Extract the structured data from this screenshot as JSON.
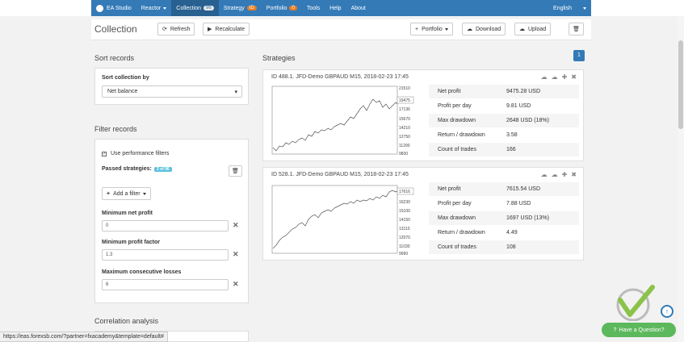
{
  "nav": {
    "brand": "EA Studio",
    "items": [
      {
        "label": "Reactor",
        "badge": "",
        "dropdown": true
      },
      {
        "label": "Collection",
        "badge": "96",
        "active": true
      },
      {
        "label": "Strategy",
        "badge": "ID"
      },
      {
        "label": "Portfolio",
        "badge": "0"
      },
      {
        "label": "Tools"
      },
      {
        "label": "Help"
      },
      {
        "label": "About"
      }
    ],
    "language": "English"
  },
  "header": {
    "title": "Collection",
    "refresh": "Refresh",
    "recalculate": "Recalculate",
    "portfolio": "Portfolio",
    "download": "Download",
    "upload": "Upload"
  },
  "sort": {
    "section_title": "Sort records",
    "label": "Sort collection by",
    "value": "Net balance"
  },
  "filter": {
    "section_title": "Filter records",
    "use_performance": "Use performance filters",
    "passed_label": "Passed strategies:",
    "passed_badge": "3 of 96",
    "add_filter": "Add a filter",
    "min_net_profit_label": "Minimum net profit",
    "min_net_profit_value": "0",
    "min_profit_factor_label": "Minimum profit factor",
    "min_profit_factor_value": "1.3",
    "max_consec_losses_label": "Maximum consecutive losses",
    "max_consec_losses_value": "6"
  },
  "correlation": {
    "section_title": "Correlation analysis"
  },
  "strategies": {
    "section_title": "Strategies",
    "page": "1",
    "cards": [
      {
        "title": "ID 488.1. JFD-Demo GBPAUD M15, 2018-02-23 17:45",
        "axis": [
          "21510",
          "19475",
          "17136",
          "15670",
          "14210",
          "12750",
          "11290",
          "9830"
        ],
        "stats": [
          {
            "name": "Net profit",
            "value": "9475.28 USD"
          },
          {
            "name": "Profit per day",
            "value": "9.81 USD"
          },
          {
            "name": "Max drawdown",
            "value": "2648 USD (18%)"
          },
          {
            "name": "Return / drawdown",
            "value": "3.58"
          },
          {
            "name": "Count of trades",
            "value": "166"
          }
        ]
      },
      {
        "title": "ID 528.1. JFD-Demo GBPAUD M15, 2018-02-23 17:45",
        "axis": [
          "17616",
          "16230",
          "15100",
          "14150",
          "13110",
          "12070",
          "11030",
          "9990"
        ],
        "stats": [
          {
            "name": "Net profit",
            "value": "7615.54 USD"
          },
          {
            "name": "Profit per day",
            "value": "7.88 USD"
          },
          {
            "name": "Max drawdown",
            "value": "1697 USD (13%)"
          },
          {
            "name": "Return / drawdown",
            "value": "4.49"
          },
          {
            "name": "Count of trades",
            "value": "108"
          }
        ]
      }
    ]
  },
  "status_url": "https://eas.forexsb.com/?partner=fxacademy&template=default#",
  "help_button": "Have a Question?",
  "colors": {
    "accent": "#337ab7",
    "help": "#5cb85c"
  }
}
